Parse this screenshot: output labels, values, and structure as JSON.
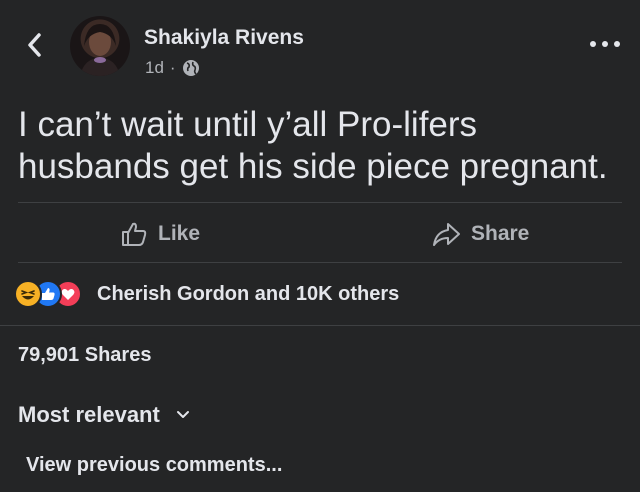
{
  "header": {
    "author_name": "Shakiyla Rivens",
    "timestamp": "1d",
    "separator": "·",
    "privacy_icon": "globe-icon",
    "back_icon": "chevron-left-icon",
    "more_icon": "more-horizontal-icon"
  },
  "post": {
    "text": "I can’t wait until y’all Pro-lifers husbands get his side piece pregnant."
  },
  "actions": {
    "like_label": "Like",
    "like_icon": "thumbs-up-icon",
    "share_label": "Share",
    "share_icon": "share-arrow-icon"
  },
  "reactions": {
    "icons": [
      "haha-reaction-icon",
      "like-reaction-icon",
      "love-reaction-icon"
    ],
    "summary": "Cherish Gordon and 10K others"
  },
  "stats": {
    "shares": "79,901 Shares"
  },
  "comments": {
    "sort_label": "Most relevant",
    "sort_icon": "chevron-down-icon",
    "view_previous": "View previous comments..."
  },
  "colors": {
    "background": "#242526",
    "text": "#e4e6eb",
    "secondary_text": "#b0b3b8",
    "divider": "#3e4042",
    "like_blue": "#2078f4",
    "love_red": "#f33e58",
    "haha_yellow": "#f7b125"
  }
}
